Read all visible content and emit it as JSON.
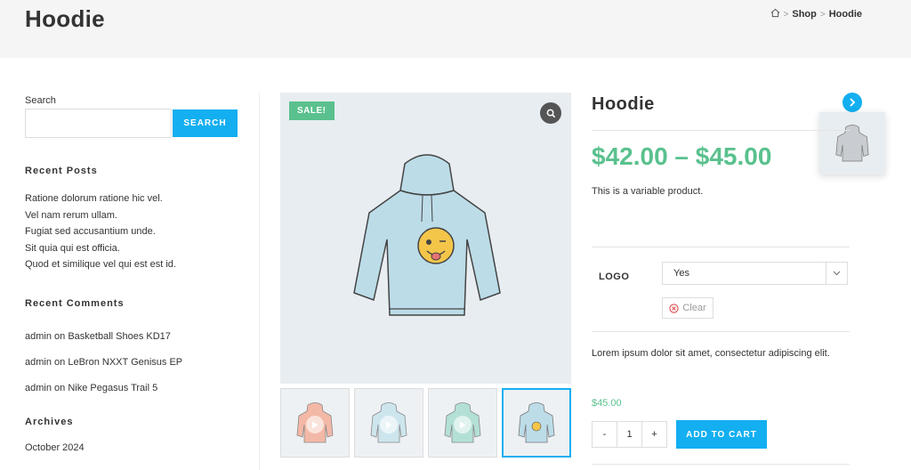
{
  "header": {
    "title": "Hoodie",
    "breadcrumb": {
      "shop": "Shop",
      "current": "Hoodie"
    }
  },
  "sidebar": {
    "search": {
      "label": "Search",
      "placeholder": "",
      "button": "SEARCH"
    },
    "recent_posts": {
      "title": "Recent Posts",
      "items": [
        "Ratione dolorum ratione hic vel.",
        "Vel nam rerum ullam.",
        "Fugiat sed accusantium unde.",
        "Sit quia qui est officia.",
        "Quod et similique vel qui est est id."
      ]
    },
    "recent_comments": {
      "title": "Recent Comments",
      "items": [
        {
          "author": "admin",
          "on": "on",
          "post": "Basketball Shoes KD17"
        },
        {
          "author": "admin",
          "on": "on",
          "post": "LeBron NXXT Genisus EP"
        },
        {
          "author": "admin",
          "on": "on",
          "post": "Nike Pegasus Trail 5"
        }
      ]
    },
    "archives": {
      "title": "Archives",
      "items": [
        "October 2024"
      ]
    }
  },
  "gallery": {
    "sale_badge": "SALE!",
    "thumbnails": [
      {
        "color": "orange",
        "video": true
      },
      {
        "color": "light-blue",
        "video": true
      },
      {
        "color": "teal",
        "video": true
      },
      {
        "color": "blue",
        "video": false
      }
    ]
  },
  "product": {
    "title": "Hoodie",
    "price_range": "$42.00 – $45.00",
    "description": "This is a variable product.",
    "variation": {
      "label": "LOGO",
      "selected": "Yes",
      "clear": "Clear"
    },
    "short_description": "Lorem ipsum dolor sit amet, consectetur adipiscing elit.",
    "variation_price": "$45.00",
    "quantity": {
      "minus": "-",
      "value": "1",
      "plus": "+"
    },
    "add_to_cart": "ADD TO CART"
  },
  "colors": {
    "accent": "#13aff0",
    "price": "#5ac18e",
    "sale": "#5ac18e"
  }
}
